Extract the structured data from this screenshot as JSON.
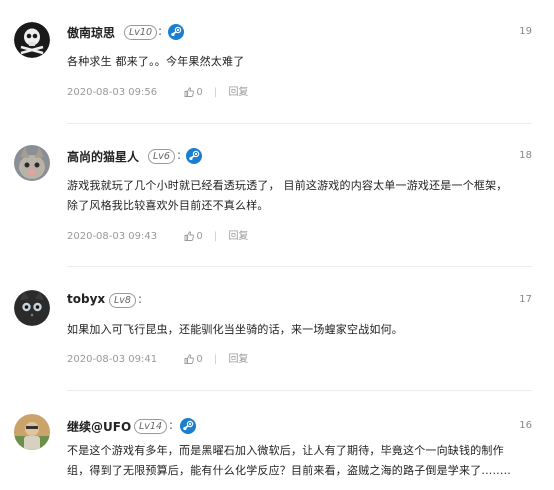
{
  "comments": [
    {
      "username": "傲南琼思",
      "level": "Lv10",
      "has_steam": true,
      "floor": "19",
      "text_lines": [
        "各种求生 都来了。。今年果然太难了"
      ],
      "time": "2020-08-03 09:56",
      "likes": "0",
      "reply_label": "回复"
    },
    {
      "username": "高尚的猫星人",
      "level": "Lv6",
      "has_steam": true,
      "floor": "18",
      "text_lines": [
        "游戏我就玩了几个小时就已经看透玩透了，  目前这游戏的内容太单一游戏还是一个框架，",
        "除了风格我比较喜欢外目前还不真么样。"
      ],
      "time": "2020-08-03 09:43",
      "likes": "0",
      "reply_label": "回复"
    },
    {
      "username": "tobyx",
      "level": "Lv8",
      "has_steam": false,
      "floor": "17",
      "text_lines": [
        "如果加入可飞行昆虫，还能驯化当坐骑的话，来一场蝗家空战如何。"
      ],
      "time": "2020-08-03 09:41",
      "likes": "0",
      "reply_label": "回复"
    },
    {
      "username": "继续@UFO",
      "level": "Lv14",
      "has_steam": true,
      "floor": "16",
      "text_lines": [
        "不是这个游戏有多年，而是黑曜石加入微软后，让人有了期待，毕竟这个一向缺钱的制作",
        "组，得到了无限预算后，能有什么化学反应？目前来看，盗贼之海的路子倒是学来了........"
      ],
      "time": "",
      "likes": "",
      "reply_label": ""
    }
  ],
  "colors": {
    "steam_blue": "#1b7fd1",
    "meta_gray": "#999999",
    "divider": "#ececec"
  }
}
